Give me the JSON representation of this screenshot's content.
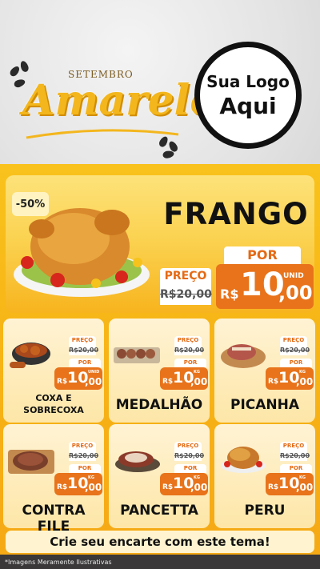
{
  "header": {
    "small_title": "SETEMBRO",
    "big_title": "Amarelo",
    "logo_line1": "Sua Logo",
    "logo_line2": "Aqui"
  },
  "hero": {
    "discount": "-50%",
    "name": "FRANGO",
    "preco_label": "PREÇO",
    "old_price": "R$20,00",
    "por_label": "POR",
    "currency": "R$",
    "new_int": "10",
    "new_dec": ",00",
    "unit": "UNID"
  },
  "products": [
    {
      "name": "COXA E SOBRECOXA",
      "preco_label": "PREÇO",
      "old_price": "R$20,00",
      "por_label": "POR",
      "currency": "R$",
      "new_int": "10",
      "new_dec": ",00",
      "unit": "UNID",
      "icon": "chicken-pot-icon"
    },
    {
      "name": "MEDALHÃO",
      "preco_label": "PREÇO",
      "old_price": "R$20,00",
      "por_label": "POR",
      "currency": "R$",
      "new_int": "10",
      "new_dec": ",00",
      "unit": "KG",
      "icon": "medallion-skewers-icon"
    },
    {
      "name": "PICANHA",
      "preco_label": "PREÇO",
      "old_price": "R$20,00",
      "por_label": "POR",
      "currency": "R$",
      "new_int": "10",
      "new_dec": ",00",
      "unit": "KG",
      "icon": "picanha-board-icon"
    },
    {
      "name": "CONTRA FILE",
      "preco_label": "PREÇO",
      "old_price": "R$20,00",
      "por_label": "POR",
      "currency": "R$",
      "new_int": "10",
      "new_dec": ",00",
      "unit": "KG",
      "icon": "steak-icon"
    },
    {
      "name": "PANCETTA",
      "preco_label": "PREÇO",
      "old_price": "R$20,00",
      "por_label": "POR",
      "currency": "R$",
      "new_int": "10",
      "new_dec": ",00",
      "unit": "KG",
      "icon": "pancetta-icon"
    },
    {
      "name": "PERU",
      "preco_label": "PREÇO",
      "old_price": "R$20,00",
      "por_label": "POR",
      "currency": "R$",
      "new_int": "10",
      "new_dec": ",00",
      "unit": "KG",
      "icon": "turkey-icon"
    }
  ],
  "footer": {
    "banner": "Crie seu encarte com este tema!",
    "disclaimer": "*Imagens Meramente Ilustrativas"
  },
  "colors": {
    "yellow": "#f9c21c",
    "orange": "#e8731a",
    "dark": "#111111"
  }
}
